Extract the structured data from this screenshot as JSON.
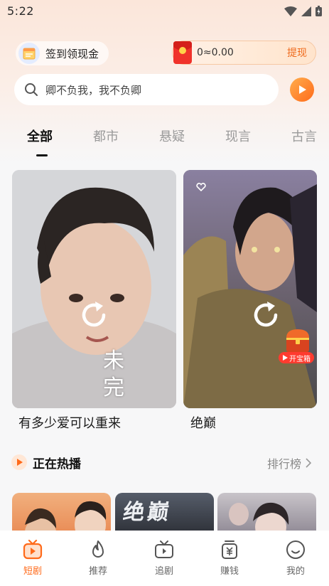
{
  "status_bar": {
    "time": "5:22"
  },
  "header": {
    "checkin_label": "签到领现金",
    "wallet_balance": "0≈0.00",
    "withdraw_label": "提现"
  },
  "search": {
    "placeholder": "卿不负我，我不负卿"
  },
  "tabs": [
    {
      "label": "全部",
      "active": true
    },
    {
      "label": "都市",
      "active": false
    },
    {
      "label": "悬疑",
      "active": false
    },
    {
      "label": "现言",
      "active": false
    },
    {
      "label": "古言",
      "active": false
    }
  ],
  "cards": [
    {
      "title": "有多少爱可以重来",
      "overlay_text": "未完"
    },
    {
      "title": "绝巅",
      "badge": "开宝箱"
    }
  ],
  "hot_section": {
    "title": "正在热播",
    "rank_label": "排行榜"
  },
  "thumbs": [
    {
      "caption": ""
    },
    {
      "caption": "绝巅"
    },
    {
      "caption": ""
    }
  ],
  "tabbar": [
    {
      "label": "短剧",
      "icon": "tv-home-icon",
      "active": true
    },
    {
      "label": "推荐",
      "icon": "flame-icon",
      "active": false
    },
    {
      "label": "追剧",
      "icon": "tv-icon",
      "active": false
    },
    {
      "label": "赚钱",
      "icon": "money-bag-icon",
      "active": false
    },
    {
      "label": "我的",
      "icon": "smile-face-icon",
      "active": false
    }
  ],
  "colors": {
    "accent": "#ff6a1a",
    "withdraw": "#ef6a1c"
  }
}
